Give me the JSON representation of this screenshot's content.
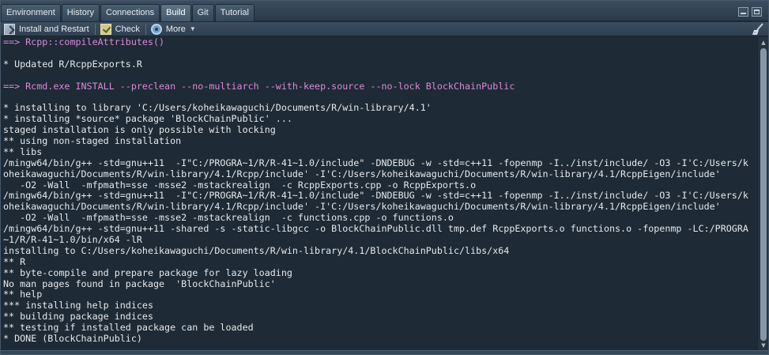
{
  "tabs": [
    "Environment",
    "History",
    "Connections",
    "Build",
    "Git",
    "Tutorial"
  ],
  "active_tab": "Build",
  "toolbar": {
    "install_label": "Install and Restart",
    "check_label": "Check",
    "more_label": "More"
  },
  "console": {
    "lines": [
      {
        "text": "==> Rcpp::compileAttributes()",
        "kind": "cmd"
      },
      {
        "text": "",
        "kind": "out"
      },
      {
        "text": "* Updated R/RcppExports.R",
        "kind": "out"
      },
      {
        "text": "",
        "kind": "out"
      },
      {
        "text": "==> Rcmd.exe INSTALL --preclean --no-multiarch --with-keep.source --no-lock BlockChainPublic",
        "kind": "cmd"
      },
      {
        "text": "",
        "kind": "out"
      },
      {
        "text": "* installing to library 'C:/Users/koheikawaguchi/Documents/R/win-library/4.1'",
        "kind": "out"
      },
      {
        "text": "* installing *source* package 'BlockChainPublic' ...",
        "kind": "out"
      },
      {
        "text": "staged installation is only possible with locking",
        "kind": "out"
      },
      {
        "text": "** using non-staged installation",
        "kind": "out"
      },
      {
        "text": "** libs",
        "kind": "out"
      },
      {
        "text": "/mingw64/bin/g++ -std=gnu++11  -I\"C:/PROGRA~1/R/R-41~1.0/include\" -DNDEBUG -w -std=c++11 -fopenmp -I../inst/include/ -O3 -I'C:/Users/k",
        "kind": "out"
      },
      {
        "text": "oheikawaguchi/Documents/R/win-library/4.1/Rcpp/include' -I'C:/Users/koheikawaguchi/Documents/R/win-library/4.1/RcppEigen/include'",
        "kind": "out"
      },
      {
        "text": "   -O2 -Wall  -mfpmath=sse -msse2 -mstackrealign  -c RcppExports.cpp -o RcppExports.o",
        "kind": "out"
      },
      {
        "text": "/mingw64/bin/g++ -std=gnu++11  -I\"C:/PROGRA~1/R/R-41~1.0/include\" -DNDEBUG -w -std=c++11 -fopenmp -I../inst/include/ -O3 -I'C:/Users/k",
        "kind": "out"
      },
      {
        "text": "oheikawaguchi/Documents/R/win-library/4.1/Rcpp/include' -I'C:/Users/koheikawaguchi/Documents/R/win-library/4.1/RcppEigen/include'",
        "kind": "out"
      },
      {
        "text": "   -O2 -Wall  -mfpmath=sse -msse2 -mstackrealign  -c functions.cpp -o functions.o",
        "kind": "out"
      },
      {
        "text": "/mingw64/bin/g++ -std=gnu++11 -shared -s -static-libgcc -o BlockChainPublic.dll tmp.def RcppExports.o functions.o -fopenmp -LC:/PROGRA",
        "kind": "out"
      },
      {
        "text": "~1/R/R-41~1.0/bin/x64 -lR",
        "kind": "out"
      },
      {
        "text": "installing to C:/Users/koheikawaguchi/Documents/R/win-library/4.1/BlockChainPublic/libs/x64",
        "kind": "out"
      },
      {
        "text": "** R",
        "kind": "out"
      },
      {
        "text": "** byte-compile and prepare package for lazy loading",
        "kind": "out"
      },
      {
        "text": "No man pages found in package  'BlockChainPublic'",
        "kind": "out"
      },
      {
        "text": "** help",
        "kind": "out"
      },
      {
        "text": "*** installing help indices",
        "kind": "out"
      },
      {
        "text": "** building package indices",
        "kind": "out"
      },
      {
        "text": "** testing if installed package can be loaded",
        "kind": "out"
      },
      {
        "text": "* DONE (BlockChainPublic)",
        "kind": "out"
      }
    ]
  },
  "icons": {
    "install": "install-restart-icon",
    "check": "check-icon",
    "more": "gear-icon",
    "clear": "broom-icon",
    "minimize": "minimize-icon",
    "maximize": "maximize-icon"
  },
  "colors": {
    "command": "#d88ad8",
    "output": "#e6e9ec",
    "background": "#1e2a35"
  }
}
